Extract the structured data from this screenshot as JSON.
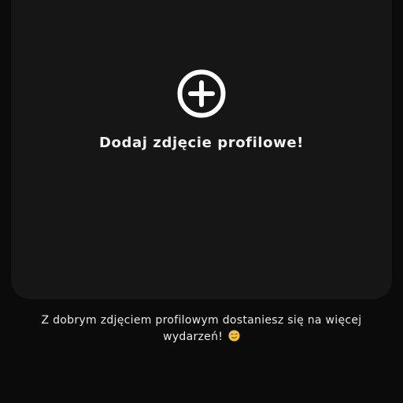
{
  "profile_photo": {
    "add_icon": "plus-circle-icon",
    "title": "Dodaj zdjęcie profilowe!"
  },
  "hint": {
    "line1": "Z dobrym zdjęciem profilowym dostaniesz się na więcej",
    "line2": "wydarzeń!",
    "emoji_icon": "smirking-face-emoji"
  },
  "colors": {
    "background": "#0b0b0b",
    "card": "#161616",
    "text": "#f2f2f2"
  }
}
